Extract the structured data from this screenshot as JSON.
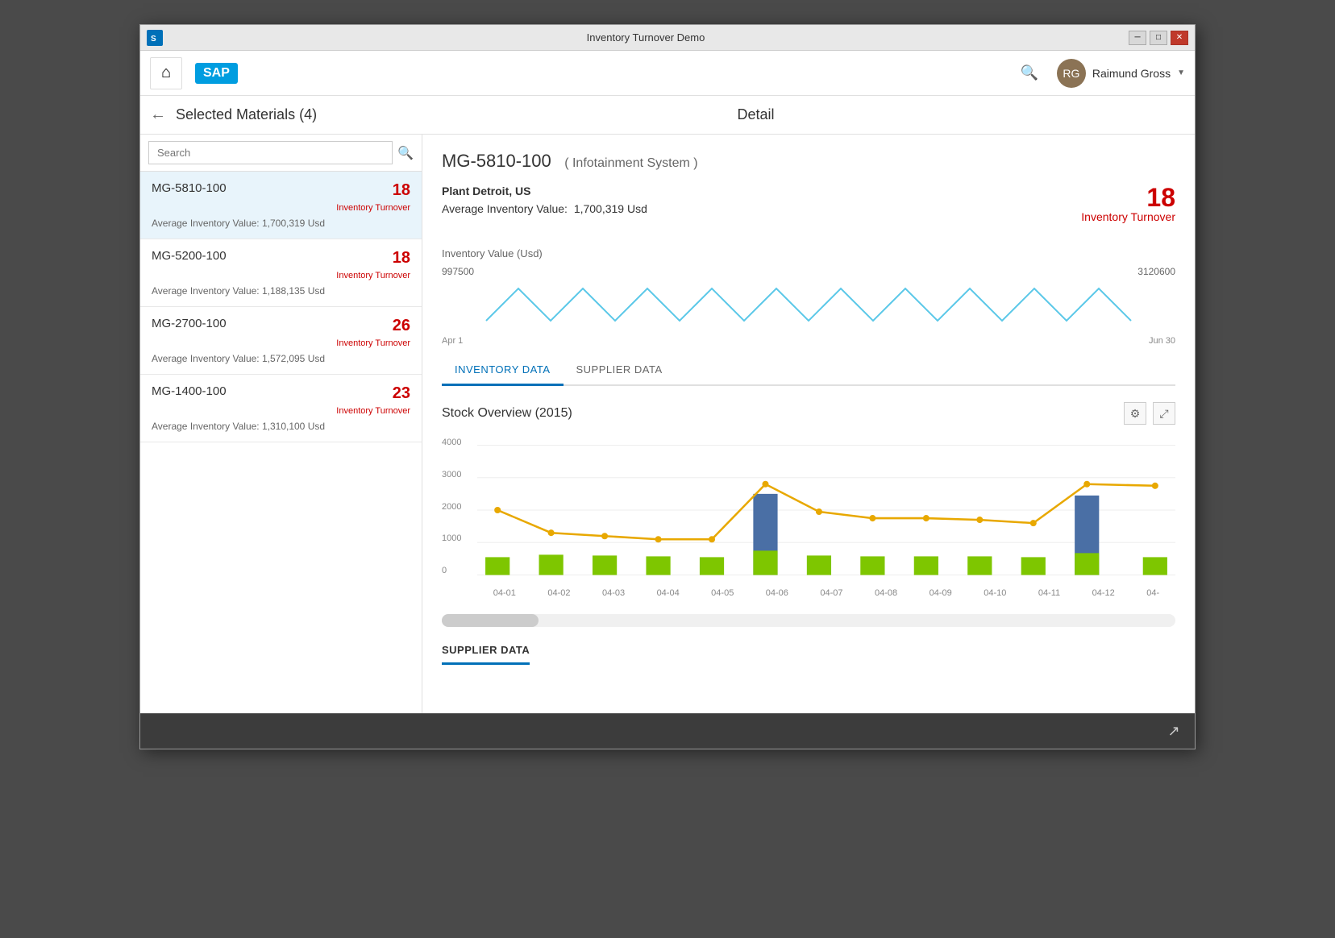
{
  "window": {
    "title": "Inventory Turnover Demo"
  },
  "titlebar": {
    "minimize_label": "─",
    "restore_label": "□",
    "close_label": "✕"
  },
  "navbar": {
    "home_icon": "⌂",
    "sap_logo": "SAP",
    "search_icon": "🔍",
    "username": "Raimund Gross",
    "chevron": "▼"
  },
  "subnav": {
    "back_icon": "←",
    "selected_materials_label": "Selected Materials (4)",
    "detail_label": "Detail"
  },
  "search": {
    "placeholder": "Search"
  },
  "materials": [
    {
      "id": "MG-5810-100",
      "turnover": 18,
      "turnover_label": "Inventory Turnover",
      "avg_value": "Average Inventory Value: 1,700,319 Usd",
      "active": true
    },
    {
      "id": "MG-5200-100",
      "turnover": 18,
      "turnover_label": "Inventory Turnover",
      "avg_value": "Average Inventory Value: 1,188,135 Usd",
      "active": false
    },
    {
      "id": "MG-2700-100",
      "turnover": 26,
      "turnover_label": "Inventory Turnover",
      "avg_value": "Average Inventory Value: 1,572,095 Usd",
      "active": false
    },
    {
      "id": "MG-1400-100",
      "turnover": 23,
      "turnover_label": "Inventory Turnover",
      "avg_value": "Average Inventory Value: 1,310,100 Usd",
      "active": false
    }
  ],
  "detail": {
    "material_id": "MG-5810-100",
    "material_desc": "( Infotainment System )",
    "plant_name": "Plant Detroit, US",
    "avg_value_label": "Average Inventory Value:",
    "avg_value": "1,700,319 Usd",
    "turnover_number": 18,
    "turnover_label": "Inventory Turnover",
    "inventory_value_label": "Inventory Value (Usd)",
    "sparkline_min": "997500",
    "sparkline_max": "3120600",
    "sparkline_date_start": "Apr 1",
    "sparkline_date_end": "Jun 30"
  },
  "tabs": [
    {
      "label": "INVENTORY DATA",
      "active": true
    },
    {
      "label": "SUPPLIER DATA",
      "active": false
    }
  ],
  "chart": {
    "title": "Stock Overview (2015)",
    "y_labels": [
      "4000",
      "3000",
      "2000",
      "1000",
      "0"
    ],
    "x_labels": [
      "04-01",
      "04-02",
      "04-03",
      "04-04",
      "04-05",
      "04-06",
      "04-07",
      "04-08",
      "04-09",
      "04-10",
      "04-11",
      "04-12",
      "04-"
    ],
    "gear_icon": "⚙",
    "expand_icon": "⤢"
  },
  "supplier_data": {
    "section_title": "SUPPLIER DATA"
  },
  "bottom_bar": {
    "share_icon": "↗"
  },
  "colors": {
    "red": "#cc0000",
    "blue": "#0070b8",
    "light_blue": "#5bc8e8",
    "yellow": "#e8a800",
    "green": "#7ec600",
    "dark_blue_bar": "#4a6fa5",
    "bg_active": "#e8f4fb"
  }
}
